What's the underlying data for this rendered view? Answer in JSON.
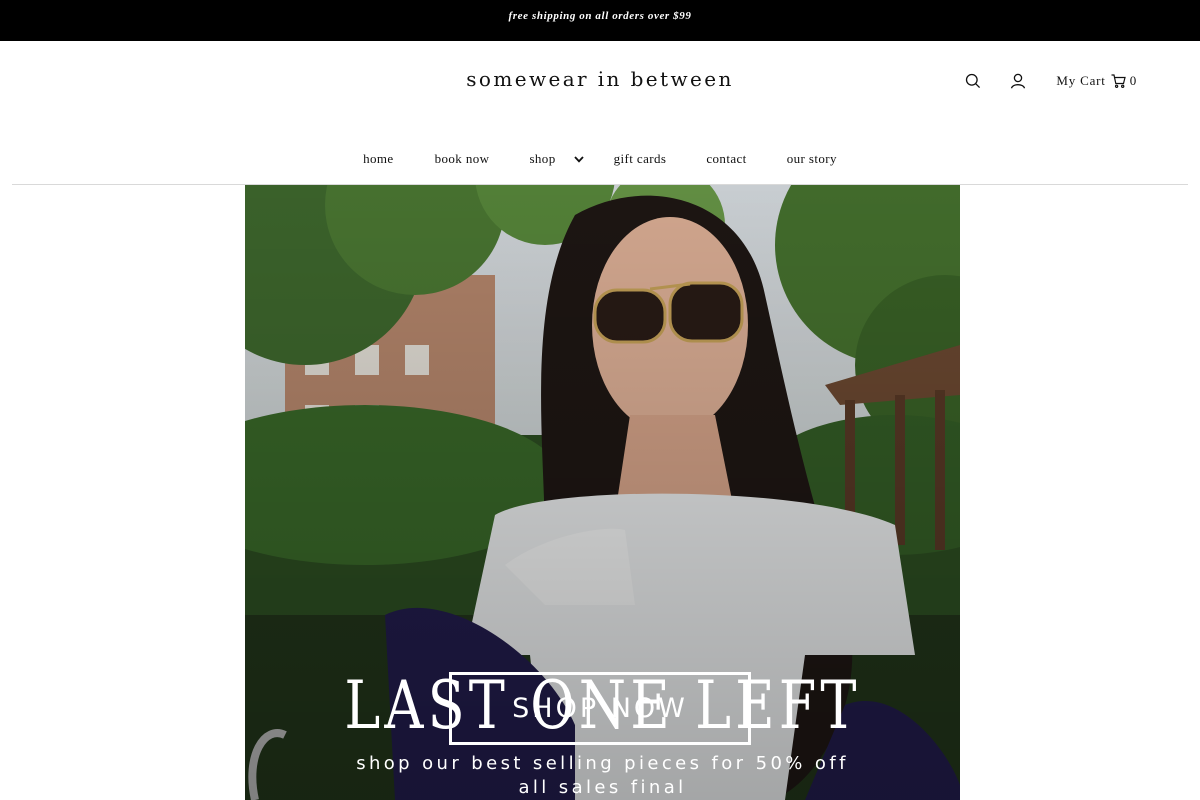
{
  "announcement": {
    "text": "free shipping on all orders over $99"
  },
  "header": {
    "logo": "somewear in between",
    "cart_label": "My Cart",
    "cart_count": "0",
    "icons": {
      "search": "search-icon",
      "account": "user-icon",
      "cart": "cart-icon"
    }
  },
  "nav": {
    "items": [
      {
        "label": "home"
      },
      {
        "label": "book now"
      },
      {
        "label": "shop"
      },
      {
        "label": "gift cards"
      },
      {
        "label": "contact"
      },
      {
        "label": "our story"
      }
    ]
  },
  "hero": {
    "title": "LAST ONE LEFT",
    "subtitle_line1": "shop our best selling pieces for 50% off",
    "subtitle_line2": "all sales final",
    "cta": "SHOP NOW"
  },
  "colors": {
    "announcement_bg": "#000000",
    "text": "#111111",
    "hero_text": "#ffffff"
  }
}
